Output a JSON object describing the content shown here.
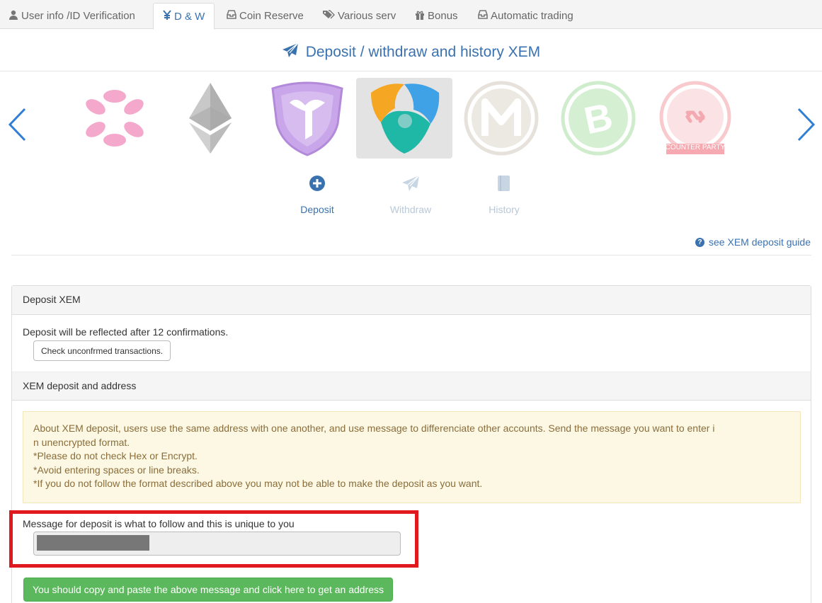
{
  "tabs": [
    {
      "label": "User info /ID Verification",
      "icon": "user-icon"
    },
    {
      "label": "D & W",
      "icon": "yen-icon",
      "active": true
    },
    {
      "label": "Coin Reserve",
      "icon": "inbox-icon"
    },
    {
      "label": "Various serv",
      "icon": "tags-icon"
    },
    {
      "label": "Bonus",
      "icon": "gift-icon"
    },
    {
      "label": "Automatic trading",
      "icon": "inbox-icon"
    }
  ],
  "heading": "Deposit / withdraw and history XEM",
  "coins": [
    {
      "name": "polkadot-coin"
    },
    {
      "name": "ethereum-coin"
    },
    {
      "name": "purple-shield-coin"
    },
    {
      "name": "xem-coin",
      "active": true
    },
    {
      "name": "monacoin-coin"
    },
    {
      "name": "bitcoin-cash-coin"
    },
    {
      "name": "counterparty-coin",
      "text": "COUNTER PARTY"
    }
  ],
  "actions": {
    "deposit": "Deposit",
    "withdraw": "Withdraw",
    "history": "History"
  },
  "guide_link": "see XEM deposit guide",
  "panel": {
    "title": "Deposit XEM",
    "confirmations": "Deposit will be reflected after 12 confirmations.",
    "check_button": "Check unconfrmed transactions.",
    "section_title": "XEM deposit and address",
    "note_lines": [
      "About XEM deposit, users use the same address with one another, and use message to differenciate other accounts. Send the message you want to enter i",
      "n unencrypted format.",
      "*Please do not check Hex or Encrypt.",
      "*Avoid entering spaces or line breaks.",
      "*If you do not follow the format described above you may not be able to make the deposit as you want."
    ],
    "message_label": "Message for deposit is what to follow and this is unique to you",
    "address_button": "You should copy and paste the above message and click here to get an address"
  },
  "colors": {
    "accent": "#3a72b0",
    "highlight": "#e0191e",
    "success": "#5cb85c",
    "note_bg": "#fcf8e3"
  }
}
